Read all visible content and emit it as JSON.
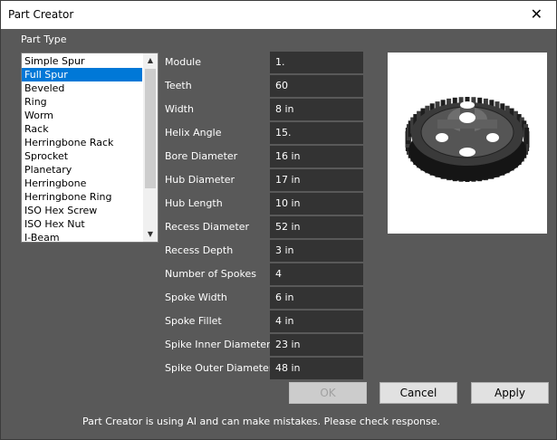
{
  "window": {
    "title": "Part Creator",
    "close_glyph": "✕"
  },
  "part_type": {
    "label": "Part Type",
    "items": [
      "Simple Spur",
      "Full Spur",
      "Beveled",
      "Ring",
      "Worm",
      "Rack",
      "Herringbone Rack",
      "Sprocket",
      "Planetary",
      "Herringbone",
      "Herringbone Ring",
      "ISO Hex Screw",
      "ISO Hex Nut",
      "I-Beam"
    ],
    "selected": "Full Spur"
  },
  "fields": [
    {
      "label": "Module",
      "value": "1."
    },
    {
      "label": "Teeth",
      "value": "60"
    },
    {
      "label": "Width",
      "value": "8 in"
    },
    {
      "label": "Helix Angle",
      "value": "15."
    },
    {
      "label": "Bore Diameter",
      "value": "16 in"
    },
    {
      "label": "Hub Diameter",
      "value": "17 in"
    },
    {
      "label": "Hub Length",
      "value": "10 in"
    },
    {
      "label": "Recess Diameter",
      "value": "52 in"
    },
    {
      "label": "Recess Depth",
      "value": "3 in"
    },
    {
      "label": "Number of Spokes",
      "value": "4"
    },
    {
      "label": "Spoke Width",
      "value": "6 in"
    },
    {
      "label": "Spoke Fillet",
      "value": "4 in"
    },
    {
      "label": "Spike Inner Diameter",
      "value": "23 in"
    },
    {
      "label": "Spike Outer Diameter",
      "value": "48 in"
    }
  ],
  "buttons": {
    "ok": "OK",
    "cancel": "Cancel",
    "apply": "Apply"
  },
  "disclaimer": "Part Creator is using AI and can make mistakes. Please check response.",
  "colors": {
    "background": "#595959",
    "selection": "#0078d7",
    "input_bg": "#333333"
  },
  "icons": {
    "close": "close-icon",
    "scroll_up": "chevron-up-icon",
    "scroll_down": "chevron-down-icon"
  }
}
